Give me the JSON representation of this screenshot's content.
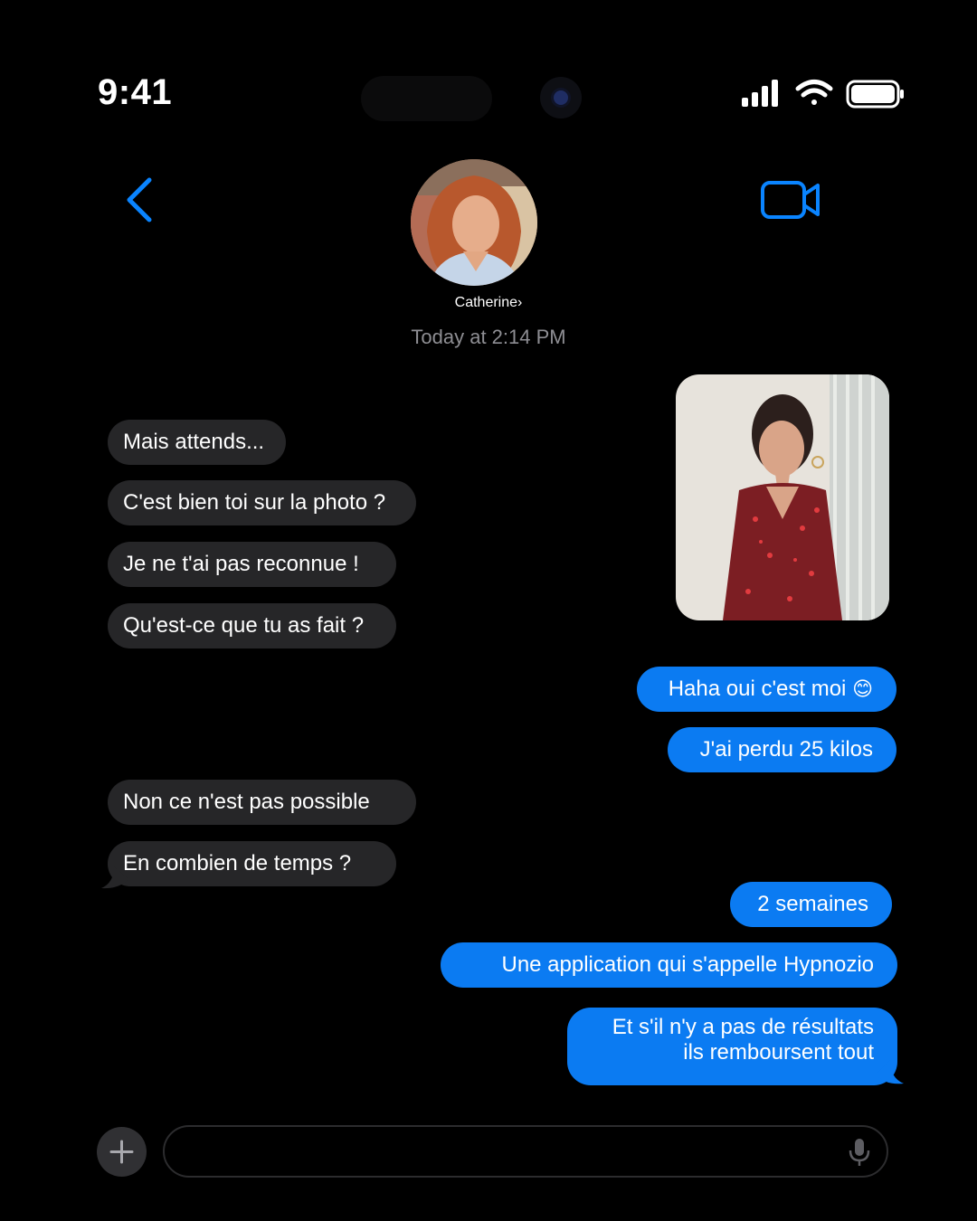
{
  "status_bar": {
    "time": "9:41",
    "icons": [
      "cellular-signal-icon",
      "wifi-icon",
      "battery-icon"
    ]
  },
  "header": {
    "back_icon": "chevron-left-icon",
    "video_icon": "video-camera-icon",
    "contact_name": "Catherine",
    "contact_chevron": "›",
    "timestamp": "Today at 2:14 PM"
  },
  "messages": [
    {
      "side": "received",
      "text": "Mais attends..."
    },
    {
      "side": "received",
      "text": "C'est bien toi sur la photo ?"
    },
    {
      "side": "received",
      "text": "Je ne t'ai pas reconnue !"
    },
    {
      "side": "received",
      "text": "Qu'est-ce que tu as fait ?"
    },
    {
      "side": "sent",
      "type": "photo"
    },
    {
      "side": "sent",
      "text": "Haha oui c'est moi",
      "emoji": "😊"
    },
    {
      "side": "sent",
      "text": "J'ai perdu 25 kilos"
    },
    {
      "side": "received",
      "text": "Non ce n'est pas possible"
    },
    {
      "side": "received",
      "text": "En combien de temps ?"
    },
    {
      "side": "sent",
      "text": "2 semaines"
    },
    {
      "side": "sent",
      "text": "Une application qui s'appelle Hypnozio"
    },
    {
      "side": "sent",
      "lines": [
        "Et s'il n'y a pas de résultats",
        "ils remboursent tout"
      ]
    }
  ],
  "composer": {
    "placeholder": "",
    "plus_icon": "plus-icon",
    "mic_icon": "microphone-icon"
  },
  "colors": {
    "background": "#000000",
    "sent_bubble": "#0b7bf2",
    "received_bubble": "#262628",
    "accent": "#0a84ff",
    "timestamp": "#8e8e93"
  }
}
